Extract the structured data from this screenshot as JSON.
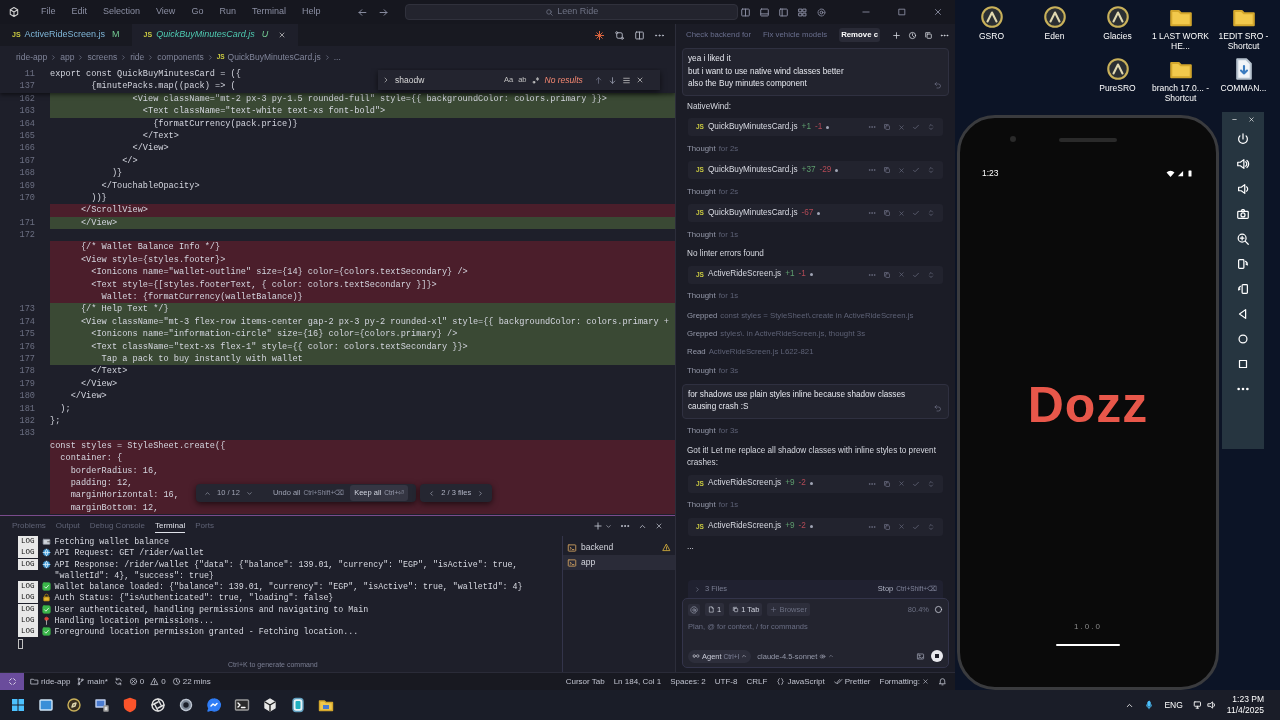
{
  "title_bar": {
    "menu": [
      "File",
      "Edit",
      "Selection",
      "View",
      "Go",
      "Run",
      "Terminal",
      "Help"
    ],
    "search": "Leen Ride"
  },
  "editor_tabs": [
    {
      "icon_text": "JS",
      "label": "ActiveRideScreen.js",
      "badge": "M",
      "selected": false
    },
    {
      "icon_text": "JS",
      "label": "QuickBuyMinutesCard.js",
      "badge": "U",
      "selected": true
    }
  ],
  "breadcrumbs": [
    {
      "label": "ride-app"
    },
    {
      "label": "app"
    },
    {
      "label": "screens"
    },
    {
      "label": "ride"
    },
    {
      "label": "components"
    },
    {
      "label": "QuickBuyMinutesCard.js",
      "icon_text": "JS"
    },
    {
      "label": "..."
    }
  ],
  "code": {
    "sticky": [
      {
        "number": "11",
        "text": "export const QuickBuyMinutesCard = ({"
      },
      {
        "number": "137",
        "text": "        {minutePacks.map((pack) => ("
      }
    ],
    "lines": [
      {
        "number": "162",
        "text": "                <View className=\"mt-2 px-3 py-1.5 rounded-full\" style={{ backgroundColor: colors.primary }}>",
        "kind": "added"
      },
      {
        "number": "163",
        "text": "                  <Text className=\"text-white text-xs font-bold\">",
        "kind": "added"
      },
      {
        "number": "164",
        "text": "                    {formatCurrency(pack.price)}",
        "kind": "context"
      },
      {
        "number": "165",
        "text": "                  </Text>",
        "kind": "context"
      },
      {
        "number": "166",
        "text": "                </View>",
        "kind": "context"
      },
      {
        "number": "167",
        "text": "              </>",
        "kind": "context"
      },
      {
        "number": "168",
        "text": "            )}",
        "kind": "context"
      },
      {
        "number": "169",
        "text": "          </TouchableOpacity>",
        "kind": "context"
      },
      {
        "number": "170",
        "text": "        ))}",
        "kind": "context"
      },
      {
        "text": "      </ScrollView>",
        "kind": "removed"
      },
      {
        "number": "171",
        "text": "      </View>",
        "kind": "added"
      },
      {
        "number": "172",
        "kind": "context"
      },
      {
        "text": "      {/* Wallet Balance Info */}",
        "kind": "removed"
      },
      {
        "text": "      <View style={styles.footer}>",
        "kind": "removed"
      },
      {
        "text": "        <Ionicons name=\"wallet-outline\" size={14} color={colors.textSecondary} />",
        "kind": "removed"
      },
      {
        "text": "        <Text style={[styles.footerText, { color: colors.textSecondary }]}>",
        "kind": "removed"
      },
      {
        "text": "          Wallet: {formatCurrency(walletBalance)}",
        "kind": "removed"
      },
      {
        "number": "173",
        "text": "      {/* Help Text */}",
        "kind": "added"
      },
      {
        "number": "174",
        "text": "      <View className=\"mt-3 flex-row items-center gap-2 px-3 py-2 rounded-xl\" style={{ backgroundColor: colors.primary +",
        "kind": "added"
      },
      {
        "number": "175",
        "text": "        <Ionicons name=\"information-circle\" size={16} color={colors.primary} />",
        "kind": "added"
      },
      {
        "number": "176",
        "text": "        <Text className=\"text-xs flex-1\" style={{ color: colors.textSecondary }}>",
        "kind": "added"
      },
      {
        "number": "177",
        "text": "          Tap a pack to buy instantly with wallet",
        "kind": "added"
      },
      {
        "number": "178",
        "text": "        </Text>",
        "kind": "context"
      },
      {
        "number": "179",
        "text": "      </View>",
        "kind": "context"
      },
      {
        "number": "180",
        "text": "    </View>",
        "kind": "context"
      },
      {
        "number": "181",
        "text": "  );",
        "kind": "context"
      },
      {
        "number": "182",
        "text": "};",
        "kind": "context"
      },
      {
        "number": "183",
        "kind": "context"
      },
      {
        "text": "const styles = StyleSheet.create({",
        "kind": "removed"
      },
      {
        "text": "  container: {",
        "kind": "removed"
      },
      {
        "text": "    borderRadius: 16,",
        "kind": "removed"
      },
      {
        "text": "    padding: 12,",
        "kind": "removed"
      },
      {
        "text": "    marginHorizontal: 16,",
        "kind": "removed"
      },
      {
        "text": "    marginBottom: 12,",
        "kind": "removed"
      }
    ]
  },
  "find_widget": {
    "value": "shaodw",
    "options": [
      "Aa",
      "ab"
    ],
    "result": "No results"
  },
  "diff_bar": {
    "counter": "10 / 12",
    "undo": "Undo all",
    "undo_shortcut": "Ctrl+Shift+⌫",
    "keep": "Keep all",
    "keep_shortcut": "Ctrl+⏎",
    "files": "2 / 3 files"
  },
  "panel": {
    "tabs": [
      {
        "label": "Problems",
        "selected": false
      },
      {
        "label": "Output",
        "selected": false
      },
      {
        "label": "Debug Console",
        "selected": false
      },
      {
        "label": "Terminal",
        "selected": true
      },
      {
        "label": "Ports",
        "selected": false
      }
    ],
    "log": [
      {
        "level": "LOG",
        "kind": "wallet",
        "text": "Fetching wallet balance"
      },
      {
        "level": "LOG",
        "kind": "api",
        "text": "API Request: GET /rider/wallet"
      },
      {
        "level": "LOG",
        "kind": "api",
        "text": "API Response: /rider/wallet {\"data\": {\"balance\": 139.01, \"currency\": \"EGP\", \"isActive\": true, \"walletId\": 4}, \"success\": true}"
      },
      {
        "level": "LOG",
        "kind": "check",
        "text": "Wallet balance loaded: {\"balance\": 139.01, \"currency\": \"EGP\", \"isActive\": true, \"walletId\": 4}"
      },
      {
        "level": "LOG",
        "kind": "lock",
        "text": "Auth Status: {\"isAuthenticated\": true, \"loading\": false}"
      },
      {
        "level": "LOG",
        "kind": "check",
        "text": "User authenticated, handling permissions and navigating to Main"
      },
      {
        "level": "LOG",
        "kind": "pin",
        "text": "Handling location permissions..."
      },
      {
        "level": "LOG",
        "kind": "check",
        "text": "Foreground location permission granted - Fetching location..."
      }
    ],
    "hint": "Ctrl+K to generate command",
    "terminals": [
      {
        "label": "backend",
        "warning": true,
        "selected": false
      },
      {
        "label": "app",
        "warning": false,
        "selected": true
      }
    ]
  },
  "chat": {
    "tabs": [
      {
        "label": "Check backend for",
        "selected": false
      },
      {
        "label": "Fix vehicle models",
        "selected": false
      },
      {
        "label": "Remove c",
        "selected": true
      }
    ],
    "items": [
      {
        "kind": "user_message",
        "text": "yea i liked it\nbut i want to use native wind classes better\nalso the Buy minutes component"
      },
      {
        "kind": "text",
        "text": "NativeWind:"
      },
      {
        "kind": "file",
        "icon_text": "JS",
        "name": "QuickBuyMinutesCard.js",
        "added": "+1",
        "removed": "-1"
      },
      {
        "kind": "thought",
        "label": "Thought",
        "detail": "for 2s"
      },
      {
        "kind": "file",
        "icon_text": "JS",
        "name": "QuickBuyMinutesCard.js",
        "added": "+37",
        "removed": "-29"
      },
      {
        "kind": "thought",
        "label": "Thought",
        "detail": "for 2s"
      },
      {
        "kind": "file",
        "icon_text": "JS",
        "name": "QuickBuyMinutesCard.js",
        "removed": "-67"
      },
      {
        "kind": "thought",
        "label": "Thought",
        "detail": "for 1s"
      },
      {
        "kind": "text",
        "text": "No linter errors found"
      },
      {
        "kind": "file",
        "icon_text": "JS",
        "name": "ActiveRideScreen.js",
        "added": "+1",
        "removed": "-1"
      },
      {
        "kind": "thought",
        "label": "Thought",
        "detail": "for 1s"
      },
      {
        "kind": "tool",
        "label": "Grepped",
        "detail": "const styles = StyleSheet\\.create in ActiveRideScreen.js"
      },
      {
        "kind": "tool",
        "label": "Grepped",
        "detail": "styles\\. in ActiveRideScreen.js, thought 3s"
      },
      {
        "kind": "tool",
        "label": "Read",
        "detail": "ActiveRideScreen.js L622-821"
      },
      {
        "kind": "thought",
        "label": "Thought",
        "detail": "for 3s"
      },
      {
        "kind": "user_message",
        "text": "for shadows use plain styles inline because shadow classes causing crash :S"
      },
      {
        "kind": "thought",
        "label": "Thought",
        "detail": "for 3s"
      },
      {
        "kind": "text",
        "text": "Got it! Let me replace all shadow classes with inline styles to prevent crashes:"
      },
      {
        "kind": "file",
        "icon_text": "JS",
        "name": "ActiveRideScreen.js",
        "added": "+9",
        "removed": "-2"
      },
      {
        "kind": "thought",
        "label": "Thought",
        "detail": "for 1s"
      },
      {
        "kind": "file",
        "icon_text": "JS",
        "name": "ActiveRideScreen.js",
        "added": "+9",
        "removed": "-2"
      },
      {
        "kind": "text",
        "text": "..."
      }
    ],
    "files_bar": {
      "label": "3 Files",
      "stop": "Stop",
      "stop_shortcut": "Ctrl+Shift+⌫"
    },
    "composer": {
      "context_count": "1",
      "tab_chip": "1 Tab",
      "browser_chip": "Browser",
      "usage": "80.4%",
      "placeholder": "Plan, @ for context, / for commands",
      "mode": "Agent",
      "mode_shortcut": "Ctrl+I",
      "model": "claude-4.5-sonnet"
    }
  },
  "status_bar": {
    "left": [
      {
        "kind": "folder",
        "text": "ride-app"
      },
      {
        "kind": "branch",
        "text": "main*"
      },
      {
        "kind": "sync"
      },
      {
        "kind": "errors",
        "text": "0"
      },
      {
        "kind": "warnings",
        "text": "0"
      },
      {
        "kind": "time",
        "text": "22 mins"
      }
    ],
    "right": [
      {
        "kind": "text",
        "text": "Cursor Tab"
      },
      {
        "kind": "text",
        "text": "Ln 184, Col 1"
      },
      {
        "kind": "text",
        "text": "Spaces: 2"
      },
      {
        "kind": "text",
        "text": "UTF-8"
      },
      {
        "kind": "text",
        "text": "CRLF"
      },
      {
        "kind": "language",
        "text": "JavaScript"
      },
      {
        "kind": "prettier",
        "text": "Prettier"
      },
      {
        "kind": "formatting",
        "text": "Formatting:"
      }
    ]
  },
  "desktop_icons": [
    {
      "kind": "app",
      "label": "GSRO"
    },
    {
      "kind": "app",
      "label": "Eden"
    },
    {
      "kind": "app",
      "label": "Glacies"
    },
    {
      "kind": "folder",
      "label": "1 LAST WORK HE..."
    },
    {
      "kind": "folder",
      "label": "1EDIT SRO - Shortcut"
    },
    {
      "kind": "app",
      "label": "PureSRO"
    },
    {
      "kind": "folder",
      "label": "branch 17.0... - Shortcut"
    },
    {
      "kind": "file",
      "label": "COMMAN..."
    }
  ],
  "phone": {
    "time": "1:23",
    "app_name": "Dozz",
    "version": "1.0.0"
  },
  "taskbar": {
    "language": "ENG",
    "time": "1:23 PM",
    "date": "11/4/2025"
  }
}
